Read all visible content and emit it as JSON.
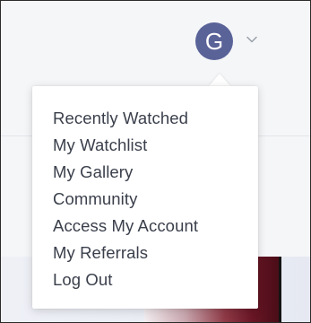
{
  "user": {
    "avatar_initial": "G",
    "avatar_color": "#5a6398"
  },
  "icons": {
    "dropdown_toggle": "chevron-down-icon"
  },
  "menu": {
    "items": [
      {
        "label": "Recently Watched"
      },
      {
        "label": "My Watchlist"
      },
      {
        "label": "My Gallery"
      },
      {
        "label": "Community"
      },
      {
        "label": "Access My Account"
      },
      {
        "label": "My Referrals"
      },
      {
        "label": "Log Out"
      }
    ]
  },
  "colors": {
    "menu_text": "#3a3f4b",
    "page_background": "#f5f6f8"
  }
}
